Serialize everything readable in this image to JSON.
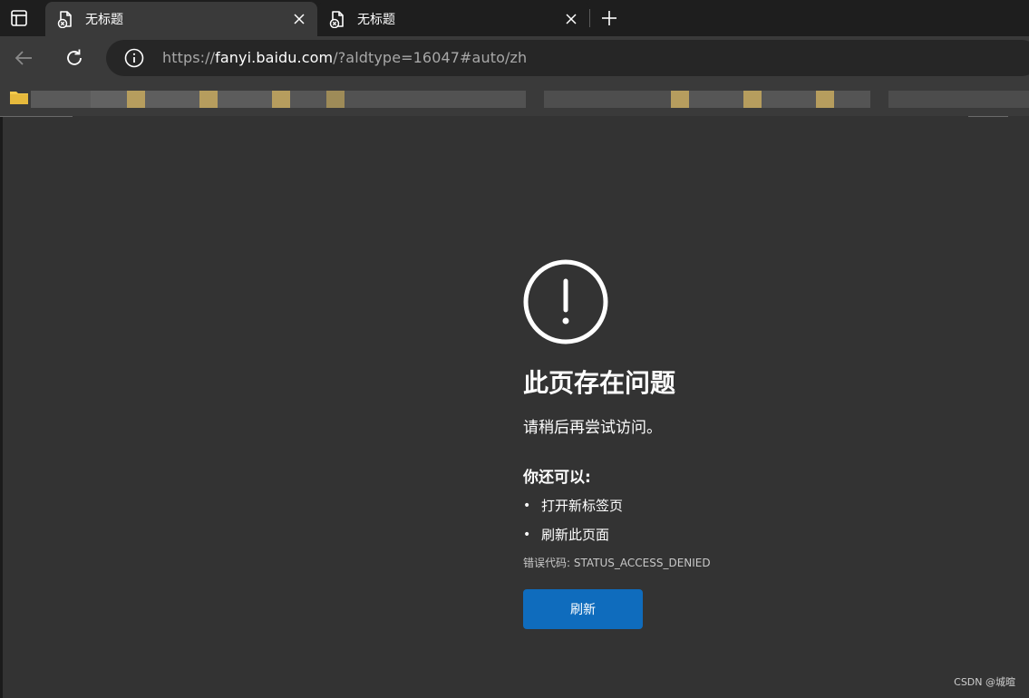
{
  "tabs": [
    {
      "title": "无标题",
      "icon": "broken-page-icon",
      "active": true
    },
    {
      "title": "无标题",
      "icon": "broken-page-icon",
      "active": false
    }
  ],
  "address": {
    "scheme": "https://",
    "host": "fanyi.baidu.com",
    "path": "/?aldtype=16047#auto/zh"
  },
  "error": {
    "heading": "此页存在问题",
    "message": "请稍后再尝试访问。",
    "subheading": "你还可以:",
    "suggestions": [
      "打开新标签页",
      "刷新此页面"
    ],
    "error_code": "错误代码: STATUS_ACCESS_DENIED",
    "button_label": "刷新"
  },
  "watermark": "CSDN @城暄",
  "colors": {
    "page_bg": "#333333",
    "chrome_bg": "#3a3a3a",
    "tabstrip_bg": "#1e1e1e",
    "button_blue": "#0f6cbd",
    "folder_yellow": "#f2c94c"
  }
}
